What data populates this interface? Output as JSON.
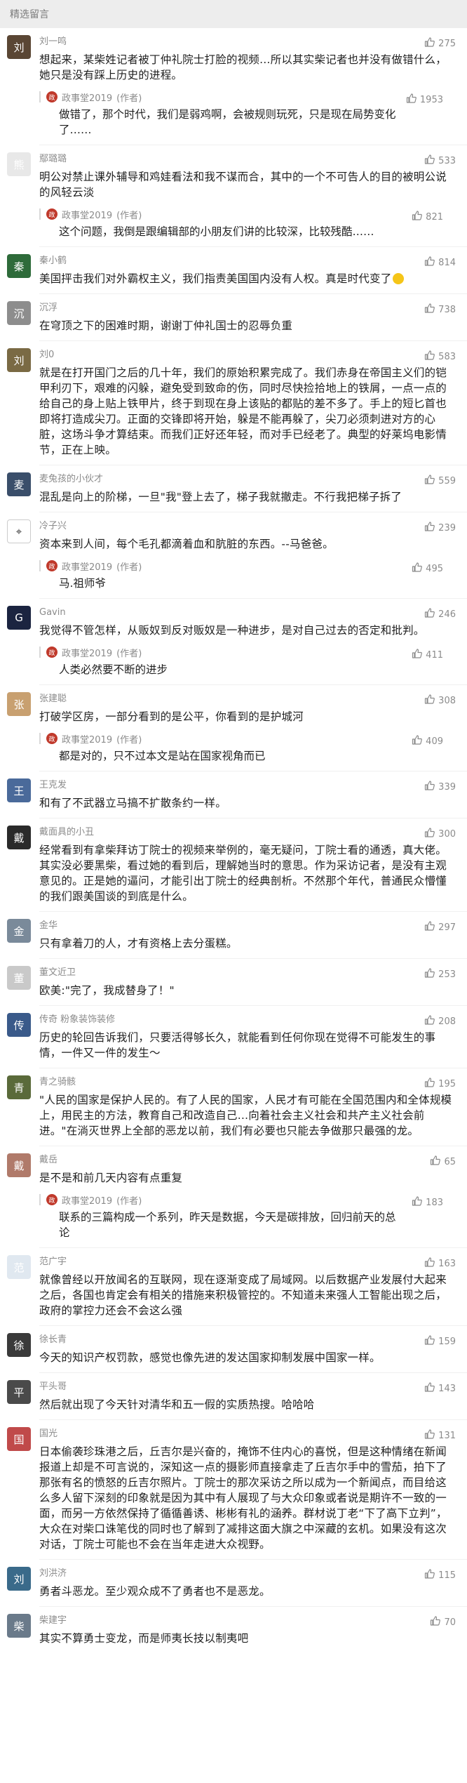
{
  "header": {
    "title": "精选留言"
  },
  "author_tag": "作者",
  "comments": [
    {
      "name": "刘一鸣",
      "likes": "275",
      "avatar_color": "#5a4634",
      "avatar_char": "刘",
      "text": "想起来，某柴姓记者被丁仲礼院士打脸的视频…所以其实柴记者也并没有做错什么，她只是没有踩上历史的进程。",
      "reply": {
        "author": "政事堂2019",
        "likes": "1953",
        "text": "做错了，那个时代，我们是弱鸡啊，会被规则玩死，只是现在局势变化了……"
      }
    },
    {
      "name": "鄢璐璐",
      "likes": "533",
      "avatar_color": "#e8e8e8",
      "avatar_char": "熊",
      "text": "明公对禁止课外辅导和鸡娃看法和我不谋而合，其中的一个不可告人的目的被明公说的风轻云淡",
      "reply": {
        "author": "政事堂2019",
        "likes": "821",
        "text": "这个问题，我倒是跟编辑部的小朋友们讲的比较深，比较残酷……"
      }
    },
    {
      "name": "秦小鹤",
      "likes": "814",
      "avatar_color": "#2e6b3a",
      "avatar_char": "秦",
      "text": "美国抨击我们对外霸权主义，我们指责美国国内没有人权。真是时代变了"
    },
    {
      "name": "沉浮",
      "likes": "738",
      "avatar_color": "#8d8d8d",
      "avatar_char": "沉",
      "text": "在穹顶之下的困难时期，谢谢丁仲礼国士的忍辱负重"
    },
    {
      "name": "刘0",
      "likes": "583",
      "avatar_color": "#7a6a44",
      "avatar_char": "刘",
      "text": "就是在打开国门之后的几十年，我们的原始积累完成了。我们赤身在帝国主义们的铠甲利刃下，艰难的闪躲，避免受到致命的伤，同时尽快捡拾地上的铁屑，一点一点的给自己的身上贴上铁甲片，终于到现在身上该贴的都贴的差不多了。手上的短匕首也即将打造成尖刀。正面的交锋即将开始，躲是不能再躲了，尖刀必须刺进对方的心脏，这场斗争才算结束。而我们正好还年轻，而对手已经老了。典型的好莱坞电影情节，正在上映。"
    },
    {
      "name": "麦兔孩的小伙才",
      "likes": "559",
      "avatar_color": "#3a4e6a",
      "avatar_char": "麦",
      "text": "混乱是向上的阶梯，一旦\"我\"登上去了，梯子我就撤走。不行我把梯子拆了"
    },
    {
      "name": "冷子兴",
      "likes": "239",
      "avatar_color": "#ffffff",
      "avatar_char": "⌖",
      "text": "资本来到人间，每个毛孔都滴着血和肮脏的东西。--马爸爸。",
      "reply": {
        "author": "政事堂2019",
        "likes": "495",
        "text": "马.祖师爷"
      }
    },
    {
      "name": "Gavin",
      "likes": "246",
      "avatar_color": "#1b2440",
      "avatar_char": "G",
      "text": "我觉得不管怎样，从贩奴到反对贩奴是一种进步，是对自己过去的否定和批判。",
      "reply": {
        "author": "政事堂2019",
        "likes": "411",
        "text": "人类必然要不断的进步"
      }
    },
    {
      "name": "张建聪",
      "likes": "308",
      "avatar_color": "#c8a070",
      "avatar_char": "张",
      "text": "打破学区房，一部分看到的是公平，你看到的是护城河",
      "reply": {
        "author": "政事堂2019",
        "likes": "409",
        "text": "都是对的，只不过本文是站在国家视角而已"
      }
    },
    {
      "name": "王克发",
      "likes": "339",
      "avatar_color": "#4a6a9a",
      "avatar_char": "王",
      "text": "和有了不武器立马搞不扩散条约一样。"
    },
    {
      "name": "戴面具的小丑",
      "likes": "300",
      "avatar_color": "#2a2a2a",
      "avatar_char": "戴",
      "text": "经常看到有拿柴拜访丁院士的视频来举例的，毫无疑问，丁院士看的通透，真大佬。其实没必要黑柴，看过她的看到后，理解她当时的意思。作为采访记者，是没有主观意见的。正是她的逼问，才能引出丁院士的经典剖析。不然那个年代，普通民众懵懂的我们跟美国谈的到底是什么。"
    },
    {
      "name": "金华",
      "likes": "297",
      "avatar_color": "#7a8a9a",
      "avatar_char": "金",
      "text": "只有拿着刀的人，才有资格上去分蛋糕。"
    },
    {
      "name": "董文近卫",
      "likes": "253",
      "avatar_color": "#c9c9c9",
      "avatar_char": "董",
      "text": "欧美:\"完了，我成替身了！\""
    },
    {
      "name": "传奇 粉象装饰装修",
      "likes": "208",
      "avatar_color": "#3a5a8a",
      "avatar_char": "传",
      "text": "历史的轮回告诉我们，只要活得够长久，就能看到任何你现在觉得不可能发生的事情，一件又一件的发生～"
    },
    {
      "name": "青之骑骸",
      "likes": "195",
      "avatar_color": "#5a6a3a",
      "avatar_char": "青",
      "text": "\"人民的国家是保护人民的。有了人民的国家，人民才有可能在全国范围内和全体规模上，用民主的方法，教育自己和改造自己…向着社会主义社会和共产主义社会前进。\"在淌灭世界上全部的恶龙以前，我们有必要也只能去争做那只最强的龙。"
    },
    {
      "name": "戴岳",
      "likes": "65",
      "avatar_color": "#b07a6a",
      "avatar_char": "戴",
      "text": "是不是和前几天内容有点重复",
      "reply": {
        "author": "政事堂2019",
        "likes": "183",
        "text": "联系的三篇构成一个系列，昨天是数据，今天是碳排放，回归前天的总论"
      }
    },
    {
      "name": "范广宇",
      "likes": "163",
      "avatar_color": "#e0e8f0",
      "avatar_char": "范",
      "text": "就像曾经以开放闻名的互联网，现在逐渐变成了局域网。以后数据产业发展付大起来之后，各国也肯定会有相关的措施来积极管控的。不知道未来强人工智能出现之后，政府的掌控力还会不会这么强"
    },
    {
      "name": "徐长青",
      "likes": "159",
      "avatar_color": "#3a3a3a",
      "avatar_char": "徐",
      "text": "今天的知识产权罚款，感觉也像先进的发达国家抑制发展中国家一样。"
    },
    {
      "name": "平头哥",
      "likes": "143",
      "avatar_color": "#4a4a4a",
      "avatar_char": "平",
      "text": "然后就出现了今天针对清华和五一假的实质热搜。哈哈哈"
    },
    {
      "name": "国光",
      "likes": "131",
      "avatar_color": "#c04a4a",
      "avatar_char": "国",
      "text": "日本偷袭珍珠港之后，丘吉尔是兴奋的，掩饰不住内心的喜悦，但是这种情绪在新闻报道上却是不可言说的，深知这一点的摄影师直接拿走了丘吉尔手中的雪茄，拍下了那张有名的愤怒的丘吉尔照片。丁院士的那次采访之所以成为一个新闻点，而目给这么多人留下深刻的印象就是因为其中有人展现了与大众印象或者说是期许不一致的一面，而另一方依然保持了循循善诱、彬彬有礼的涵养。群材说丁老“下了高下立判”，大众在对柴口诛笔伐的同时也了解到了减排这面大旗之中深藏的玄机。如果没有这次对话，丁院士可能也不会在当年走进大众视野。"
    },
    {
      "name": "刘洪济",
      "likes": "115",
      "avatar_color": "#3a6a8a",
      "avatar_char": "刘",
      "text": "勇者斗恶龙。至少观众成不了勇者也不是恶龙。"
    },
    {
      "name": "柴建宇",
      "likes": "70",
      "avatar_color": "#6a7a8a",
      "avatar_char": "柴",
      "text": "其实不算勇士变龙，而是师夷长技以制夷吧"
    }
  ]
}
